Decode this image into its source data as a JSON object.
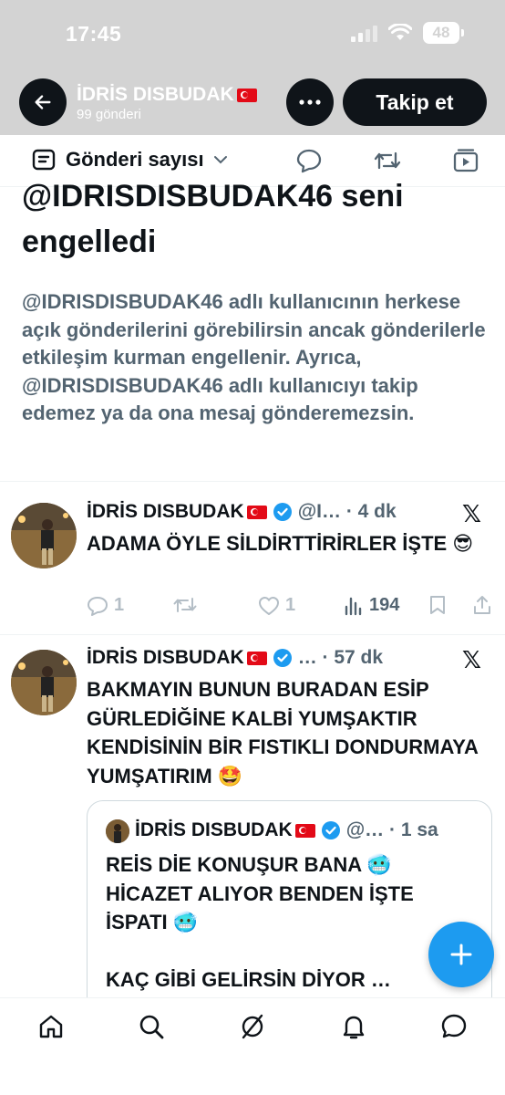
{
  "status_bar": {
    "time": "17:45",
    "battery": "48"
  },
  "header": {
    "name": "İDRİS DISBUDAK",
    "post_count": "99 gönderi",
    "follow_label": "Takip et"
  },
  "tabs": {
    "filter_label": "Gönderi sayısı"
  },
  "blocked": {
    "title": "@IDRISDISBUDAK46 seni engelledi",
    "body": "@IDRISDISBUDAK46 adlı kullanıcının herkese açık gönderilerini görebilirsin ancak gönderilerle etkileşim kurman engellenir. Ayrıca, @IDRISDISBUDAK46 adlı kullanıcıyı takip edemez ya da ona mesaj gönderemezsin."
  },
  "tweets": [
    {
      "name": "İDRİS DISBUDAK",
      "meta": "@I… · 4 dk",
      "text": "ADAMA ÖYLE SİLDİRTTİRİRLER İŞTE 😎",
      "replies": "1",
      "likes": "1",
      "views": "194"
    },
    {
      "name": "İDRİS DISBUDAK",
      "meta": "… · 57 dk",
      "text": "BAKMAYIN BUNUN BURADAN ESİP GÜRLEDİĞİNE KALBİ YUMŞAKTIR KENDİSİNİN BİR FISTIKLI DONDURMAYA YUMŞATIRIM 🤩",
      "quote": {
        "name": "İDRİS DISBUDAK",
        "meta": "@… · 1 sa",
        "text": "REİS DİE KONUŞUR BANA 🥶\nHİCAZET ALIYOR BENDEN İŞTE İSPATI 🥶\n\nKAÇ GİBİ GELİRSİN DİYOR …"
      }
    }
  ],
  "colors": {
    "accent": "#1d9bf0",
    "header_bg": "#d3d3d3",
    "text_secondary": "#536471",
    "flag": "#e30a17"
  },
  "icons": [
    "back-arrow-icon",
    "more-icon",
    "filter-icon",
    "chevron-down-icon",
    "reply-icon",
    "retweet-icon",
    "play-icon",
    "verified-icon",
    "x-logo-icon",
    "like-icon",
    "views-icon",
    "bookmark-icon",
    "share-icon",
    "compose-plus-icon",
    "home-icon",
    "search-icon",
    "grok-icon",
    "bell-icon",
    "messages-icon"
  ]
}
